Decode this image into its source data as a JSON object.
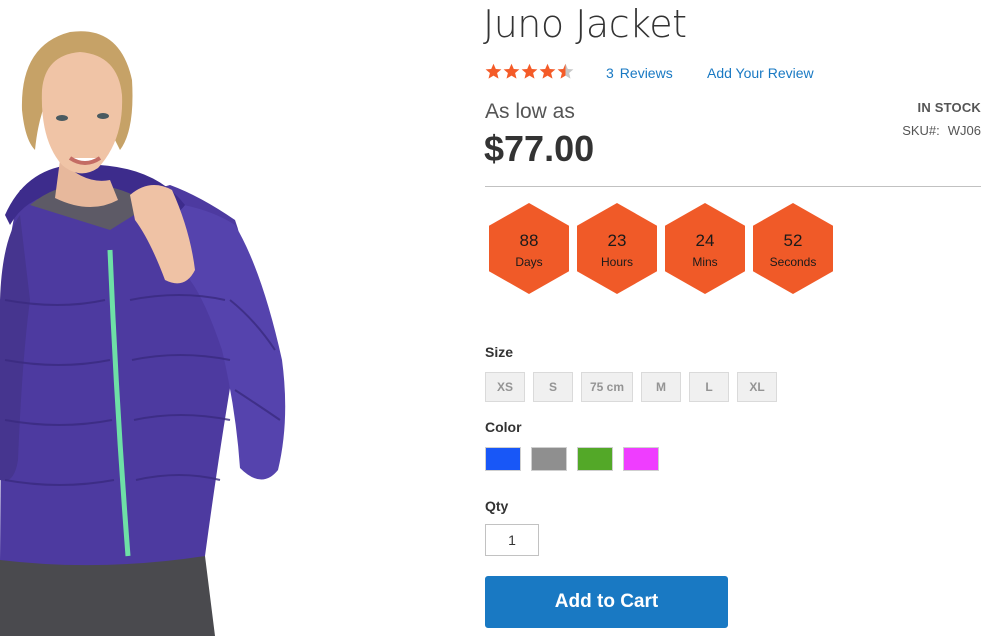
{
  "product": {
    "title": "Juno Jacket",
    "image_alt": "woman-wearing-purple-puffer-jacket",
    "rating": {
      "value": 4.5,
      "max": 5,
      "star_color": "#f45b28",
      "empty_color": "#c7c7c7"
    },
    "reviews_count": "3",
    "reviews_label": "Reviews",
    "add_review_label": "Add Your Review",
    "price_prefix": "As low as",
    "price": "$77.00",
    "stock_status": "IN STOCK",
    "sku_label": "SKU#:",
    "sku_value": "WJ06"
  },
  "countdown": {
    "color": "#f05a28",
    "items": [
      {
        "value": "88",
        "unit": "Days"
      },
      {
        "value": "23",
        "unit": "Hours"
      },
      {
        "value": "24",
        "unit": "Mins"
      },
      {
        "value": "52",
        "unit": "Seconds"
      }
    ]
  },
  "options": {
    "size_label": "Size",
    "sizes": [
      "XS",
      "S",
      "75 cm",
      "M",
      "L",
      "XL"
    ],
    "color_label": "Color",
    "colors": [
      "#1857f7",
      "#8f8f8f",
      "#53a828",
      "#ef3dff"
    ],
    "qty_label": "Qty",
    "qty_value": "1"
  },
  "actions": {
    "add_to_cart_label": "Add to Cart",
    "accent_color": "#1979c3"
  }
}
